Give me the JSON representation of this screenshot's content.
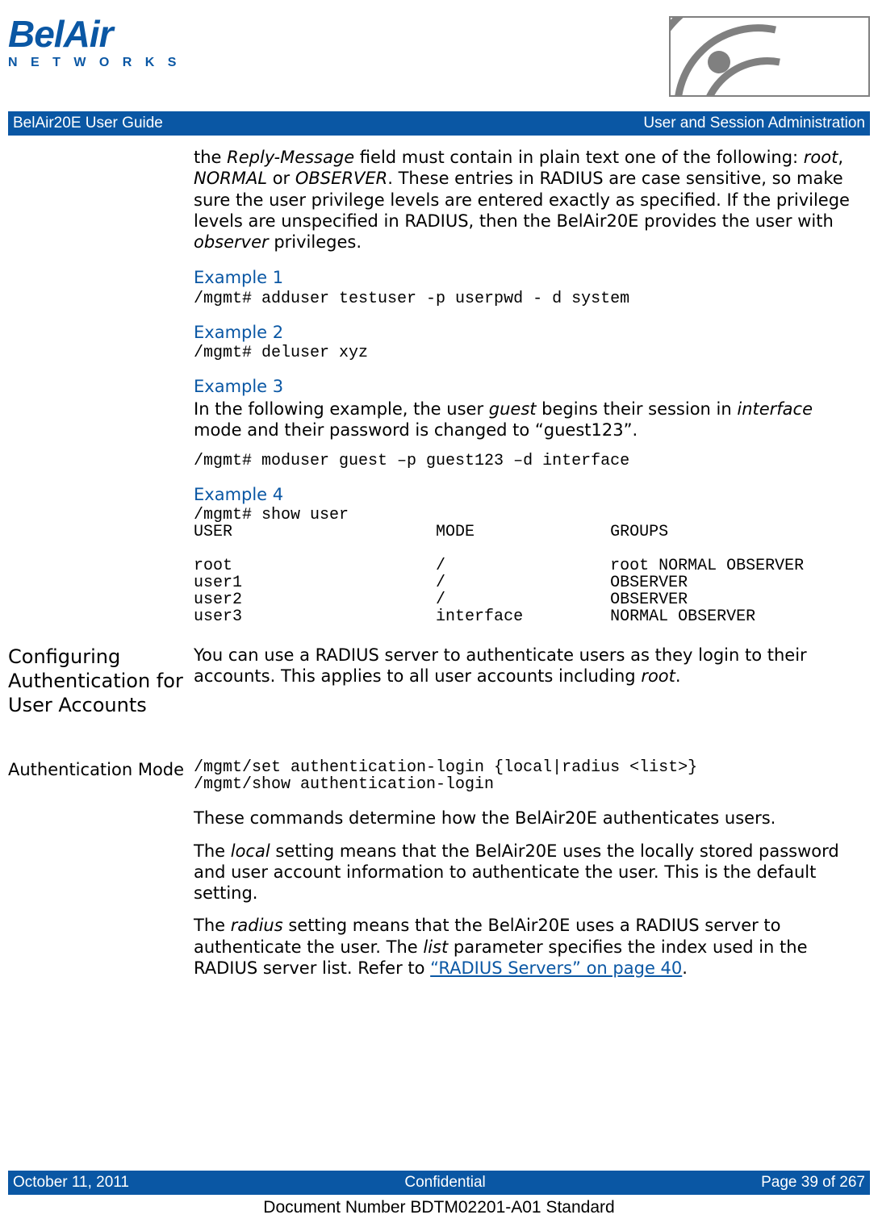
{
  "logo": {
    "line1": "BelAir",
    "line2": "N E T W O R K S"
  },
  "header": {
    "left": "BelAir20E User Guide",
    "right": "User and Session Administration"
  },
  "intro": {
    "p1_pre": "the ",
    "p1_reply": "Reply-Message",
    "p1_mid1": " field must contain in plain text one of the following: ",
    "p1_root": "root",
    "p1_comma": ", ",
    "p1_normal": "NORMAL",
    "p1_or": " or ",
    "p1_observer": "OBSERVER",
    "p1_mid2": ". These entries in RADIUS are case sensitive, so make sure the user privilege levels are entered exactly as specified. If the privilege levels are unspecified in RADIUS, then the BelAir20E provides the user with ",
    "p1_obs2": "observer",
    "p1_end": " privileges."
  },
  "ex1": {
    "title": "Example 1",
    "cmd": "/mgmt# adduser testuser -p userpwd - d system"
  },
  "ex2": {
    "title": "Example 2",
    "cmd": "/mgmt# deluser xyz"
  },
  "ex3": {
    "title": "Example 3",
    "p_pre": "In the following example, the user ",
    "p_guest": "guest",
    "p_mid": " begins their session in ",
    "p_iface": "interface",
    "p_end": " mode and their password is changed to “guest123”.",
    "cmd": "/mgmt# moduser guest –p guest123 –d interface"
  },
  "ex4": {
    "title": "Example 4",
    "block": "/mgmt# show user\nUSER                     MODE              GROUPS\n\nroot                     /                 root NORMAL OBSERVER\nuser1                    /                 OBSERVER\nuser2                    /                 OBSERVER\nuser3                    interface         NORMAL OBSERVER"
  },
  "sec1": {
    "label": "Configuring Authentication for User Accounts",
    "p_pre": "You can use a RADIUS server to authenticate users as they login to their accounts. This applies to all user accounts including ",
    "p_root": "root",
    "p_end": "."
  },
  "sec2": {
    "label": "Authentication Mode",
    "cmd": "/mgmt/set authentication-login {local|radius <list>}\n/mgmt/show authentication-login",
    "p1": "These commands determine how the BelAir20E authenticates users.",
    "p2_pre": "The ",
    "p2_local": "local",
    "p2_end": " setting means that the BelAir20E uses the locally stored password and user account information to authenticate the user. This is the default setting.",
    "p3_pre": "The ",
    "p3_radius": "radius",
    "p3_mid": " setting means that the BelAir20E uses a RADIUS server to authenticate the user. The ",
    "p3_list": "list",
    "p3_mid2": " parameter specifies the index used in the RADIUS server list. Refer to ",
    "p3_link": "“RADIUS Servers” on page 40",
    "p3_end": "."
  },
  "footer": {
    "left": "October 11, 2011",
    "mid": "Confidential",
    "right": "Page 39 of 267",
    "doc": "Document Number BDTM02201-A01 Standard"
  }
}
